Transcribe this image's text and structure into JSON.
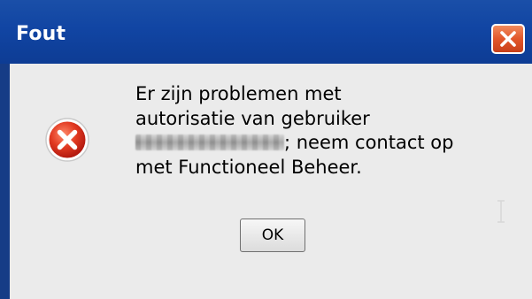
{
  "window": {
    "title": "Fout",
    "close_icon": "close-icon"
  },
  "dialog": {
    "icon": "error-icon",
    "message_lines": [
      "Er zijn problemen met",
      "autorisatie van gebruiker",
      "; neem contact op",
      "met Functioneel Beheer."
    ],
    "ok_label": "OK"
  },
  "colors": {
    "titlebar": "#1145a3",
    "close_button": "#e2562a",
    "body_background": "#ebebeb",
    "error_icon": "#d9261c"
  }
}
